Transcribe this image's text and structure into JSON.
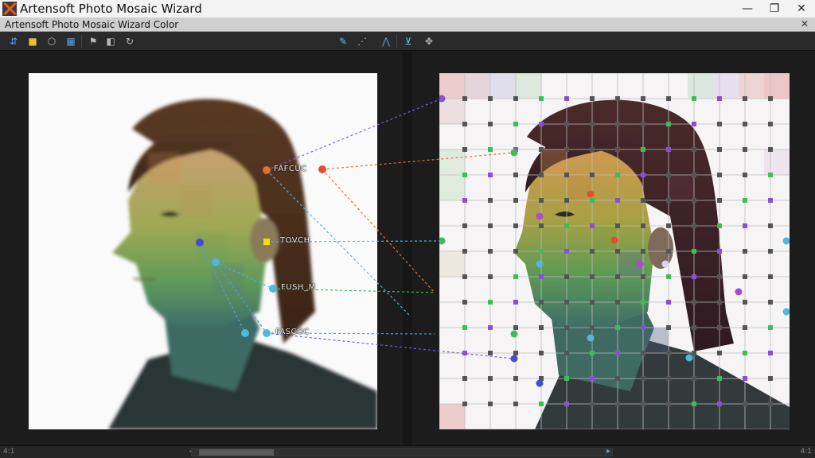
{
  "window": {
    "title": "Artensoft Photo Mosaic Wizard",
    "minimize": "—",
    "maximize": "❐",
    "close": "✕"
  },
  "menubar": {
    "title": "Artensoft Photo Mosaic Wizard Color",
    "close": "✕"
  },
  "toolbar": {
    "left_tools": [
      "select-tool-icon",
      "folder-icon",
      "tag-icon",
      "grid-icon",
      "flag-icon",
      "camera-icon",
      "refresh-icon"
    ],
    "center_tools": [
      "pen-tool-icon",
      "node-tool-icon",
      "bezier-tool-icon",
      "anchor-tool-icon",
      "target-tool-icon"
    ]
  },
  "labels": {
    "l1": "FAFCUC",
    "l2": "TOVCH",
    "l3": "FUSH_M",
    "l4": "FASCOC"
  },
  "statusbar": {
    "left": "4:1",
    "right": "4:1"
  },
  "colors": {
    "accent": "#5aa0e8",
    "orange": "#e0702a",
    "green": "#3bbd5a",
    "purple": "#8a4fd6",
    "cyan": "#4fb8e0",
    "yellow": "#f0e000"
  }
}
